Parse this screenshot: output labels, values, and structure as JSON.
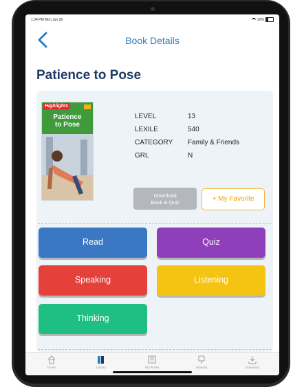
{
  "status": {
    "time": "1:34 PM  Mon Jun 28",
    "battery": "22%"
  },
  "nav": {
    "title": "Book Details"
  },
  "book": {
    "title": "Patience to Pose",
    "cover": {
      "brand": "Highlights",
      "title_line1": "Patience",
      "title_line2": "to Pose"
    },
    "meta": [
      {
        "label": "LEVEL",
        "value": "13"
      },
      {
        "label": "LEXILE",
        "value": "540"
      },
      {
        "label": "CATEGORY",
        "value": "Family & Friends"
      },
      {
        "label": "GRL",
        "value": "N"
      }
    ]
  },
  "buttons": {
    "download_line1": "Download",
    "download_line2": "Book & Quiz",
    "favorite": "+ My Favorite",
    "read": "Read",
    "quiz": "Quiz",
    "speaking": "Speaking",
    "listening": "Listening",
    "thinking": "Thinking"
  },
  "tabs": [
    {
      "label": "Home",
      "icon": "home-icon"
    },
    {
      "label": "Library",
      "icon": "library-icon",
      "active": true
    },
    {
      "label": "My Profile",
      "icon": "profile-icon"
    },
    {
      "label": "Reward",
      "icon": "reward-icon"
    },
    {
      "label": "Download",
      "icon": "download-icon"
    }
  ],
  "colors": {
    "accent": "#2c7fbf",
    "title": "#1f3a66",
    "read": "#3a78c3",
    "quiz": "#8f3fba",
    "speaking": "#e6403a",
    "listening": "#f5c412",
    "thinking": "#1fbf84",
    "favorite": "#f0a30a"
  }
}
